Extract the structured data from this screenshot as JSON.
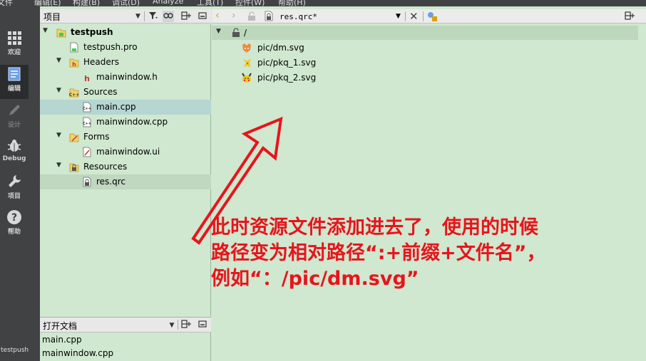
{
  "menubar": {
    "items": [
      "文件",
      "编辑(E)",
      "构建(B)",
      "调试(D)",
      "Analyze",
      "工具(T)",
      "控件(W)",
      "帮助(H)"
    ]
  },
  "modes": [
    {
      "label": "欢迎",
      "icon": "grid-icon"
    },
    {
      "label": "编辑",
      "icon": "edit-document-icon"
    },
    {
      "label": "设计",
      "icon": "pencil-icon"
    },
    {
      "label": "Debug",
      "icon": "bug-icon"
    },
    {
      "label": "项目",
      "icon": "wrench-icon"
    },
    {
      "label": "帮助",
      "icon": "help-icon"
    }
  ],
  "session_label": "testpush",
  "project_pane": {
    "title": "项目",
    "tree": [
      {
        "label": "testpush",
        "bold": true,
        "expanded": true,
        "icon": "qt-project-icon"
      },
      {
        "label": "testpush.pro",
        "icon": "pro-file-icon"
      },
      {
        "label": "Headers",
        "expanded": true,
        "icon": "headers-folder-icon"
      },
      {
        "label": "mainwindow.h",
        "icon": "header-file-icon"
      },
      {
        "label": "Sources",
        "expanded": true,
        "icon": "sources-folder-icon"
      },
      {
        "label": "main.cpp",
        "icon": "cpp-file-icon"
      },
      {
        "label": "mainwindow.cpp",
        "icon": "cpp-file-icon"
      },
      {
        "label": "Forms",
        "expanded": true,
        "icon": "forms-folder-icon"
      },
      {
        "label": "mainwindow.ui",
        "icon": "ui-file-icon"
      },
      {
        "label": "Resources",
        "expanded": true,
        "icon": "resources-folder-icon"
      },
      {
        "label": "res.qrc",
        "icon": "qrc-file-icon"
      }
    ]
  },
  "open_docs": {
    "title": "打开文档",
    "items": [
      "main.cpp",
      "mainwindow.cpp"
    ]
  },
  "editor": {
    "filename": "res.qrc*",
    "prefix": "/",
    "files": [
      {
        "path": "pic/dm.svg",
        "icon": "fox-icon"
      },
      {
        "path": "pic/pkq_1.svg",
        "icon": "pikachu-icon"
      },
      {
        "path": "pic/pkq_2.svg",
        "icon": "pikachu-face-icon"
      }
    ]
  },
  "annotation": {
    "lines": [
      "此时资源文件添加进去了，使用的时候",
      "路径变为相对路径“:+前缀+文件名”，",
      "例如“：/pic/dm.svg”"
    ],
    "color": "#e8141c"
  },
  "colors": {
    "tree_bg": "#cfe8cf",
    "modebar_bg": "#404244",
    "selection": "#b6d6d2"
  }
}
